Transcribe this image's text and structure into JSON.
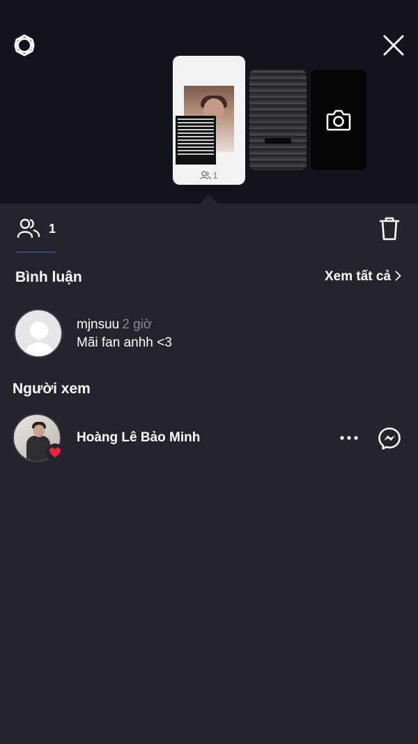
{
  "header": {
    "settings_icon": "gear-icon",
    "close_icon": "close-icon",
    "stories": [
      {
        "viewer_count": "1",
        "icon": "people-icon"
      },
      {
        "icon": "none"
      },
      {
        "icon": "camera-icon"
      }
    ]
  },
  "viewers_tab": {
    "icon": "people-icon",
    "count": "1",
    "delete_icon": "trash-icon"
  },
  "comments": {
    "title": "Bình luận",
    "see_all": "Xem tất cả",
    "items": [
      {
        "username": "mjnsuu",
        "time": "2 giờ",
        "text": "Mãi fan anhh <3"
      }
    ]
  },
  "viewers": {
    "title": "Người xem",
    "items": [
      {
        "name": "Hoàng Lê Bảo Minh",
        "reaction": "heart-icon",
        "more_icon": "more-icon",
        "message_icon": "messenger-icon"
      }
    ]
  },
  "colors": {
    "background": "#24242d",
    "header_background": "#13131b",
    "accent": "#3d6bd8",
    "muted_text": "#8a8a96",
    "heart": "#e8253a"
  }
}
